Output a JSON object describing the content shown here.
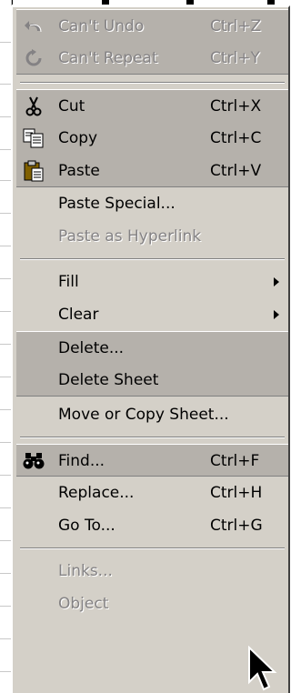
{
  "menu": {
    "items": [
      {
        "id": "undo",
        "label": "Can't Undo",
        "shortcut": "Ctrl+Z",
        "icon": "undo-icon",
        "disabled": true
      },
      {
        "id": "repeat",
        "label": "Can't Repeat",
        "shortcut": "Ctrl+Y",
        "icon": "repeat-icon",
        "disabled": true
      },
      {
        "id": "cut",
        "label": "Cut",
        "shortcut": "Ctrl+X",
        "icon": "scissors-icon",
        "disabled": false
      },
      {
        "id": "copy",
        "label": "Copy",
        "shortcut": "Ctrl+C",
        "icon": "copy-icon",
        "disabled": false
      },
      {
        "id": "paste",
        "label": "Paste",
        "shortcut": "Ctrl+V",
        "icon": "paste-icon",
        "disabled": false
      },
      {
        "id": "paste_special",
        "label": "Paste Special...",
        "shortcut": "",
        "disabled": false
      },
      {
        "id": "paste_hyperlink",
        "label": "Paste as Hyperlink",
        "shortcut": "",
        "disabled": true
      },
      {
        "id": "fill",
        "label": "Fill",
        "shortcut": "",
        "submenu": true,
        "disabled": false
      },
      {
        "id": "clear",
        "label": "Clear",
        "shortcut": "",
        "submenu": true,
        "disabled": false
      },
      {
        "id": "delete",
        "label": "Delete...",
        "shortcut": "",
        "disabled": false
      },
      {
        "id": "delete_sheet",
        "label": "Delete Sheet",
        "shortcut": "",
        "disabled": false
      },
      {
        "id": "move_copy",
        "label": "Move or Copy Sheet...",
        "shortcut": "",
        "disabled": false
      },
      {
        "id": "find",
        "label": "Find...",
        "shortcut": "Ctrl+F",
        "icon": "binoculars-icon",
        "disabled": false
      },
      {
        "id": "replace",
        "label": "Replace...",
        "shortcut": "Ctrl+H",
        "disabled": false
      },
      {
        "id": "goto",
        "label": "Go To...",
        "shortcut": "Ctrl+G",
        "disabled": false
      },
      {
        "id": "links",
        "label": "Links...",
        "shortcut": "",
        "disabled": true
      },
      {
        "id": "object",
        "label": "Object",
        "shortcut": "",
        "disabled": true
      }
    ]
  },
  "colors": {
    "menu_face": "#d4d0c8",
    "recent_band": "#b5b1ab",
    "disabled_text": "#848284"
  }
}
